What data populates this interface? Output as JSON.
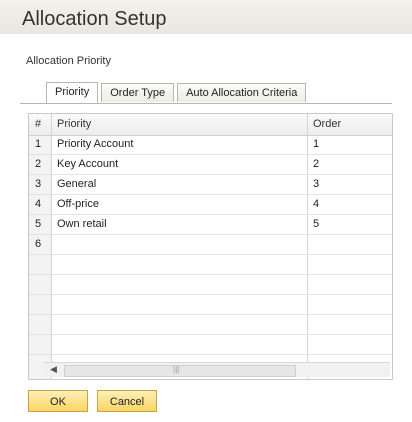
{
  "window": {
    "title": "Allocation Setup"
  },
  "section": {
    "label": "Allocation Priority"
  },
  "tabs": [
    {
      "label": "Priority",
      "active": true
    },
    {
      "label": "Order Type",
      "active": false
    },
    {
      "label": "Auto Allocation Criteria",
      "active": false
    }
  ],
  "grid": {
    "columns": [
      "#",
      "Priority",
      "Order"
    ],
    "rows": [
      {
        "num": "1",
        "priority": "Priority Account",
        "order": "1"
      },
      {
        "num": "2",
        "priority": "Key Account",
        "order": "2"
      },
      {
        "num": "3",
        "priority": "General",
        "order": "3"
      },
      {
        "num": "4",
        "priority": "Off-price",
        "order": "4"
      },
      {
        "num": "5",
        "priority": "Own retail",
        "order": "5"
      },
      {
        "num": "6",
        "priority": "",
        "order": ""
      }
    ]
  },
  "buttons": {
    "ok": "OK",
    "cancel": "Cancel"
  },
  "colors": {
    "button_fill": "#f7d565",
    "button_border": "#c9a43c"
  },
  "icons": {
    "scroll_left": "left-arrow-icon"
  }
}
